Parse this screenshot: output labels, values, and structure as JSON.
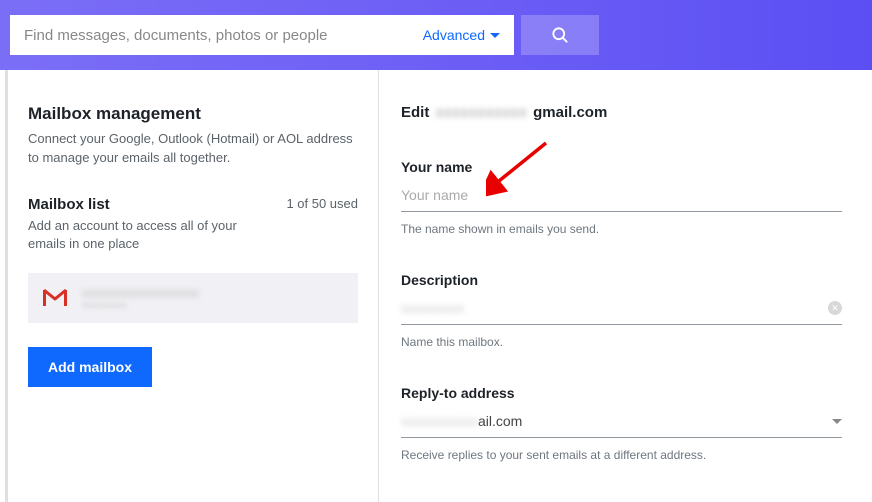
{
  "search": {
    "placeholder": "Find messages, documents, photos or people",
    "advanced_label": "Advanced"
  },
  "left": {
    "title": "Mailbox management",
    "desc": "Connect your Google, Outlook (Hotmail) or AOL address to manage your emails all together.",
    "list_title": "Mailbox list",
    "list_sub": "Add an account to access all of your emails in one place",
    "count": "1 of 50 used",
    "account_masked": "xxxxxxxxxxxxxxxxxx",
    "account_masked_sub": "xxxxxxxxx",
    "add_button": "Add mailbox"
  },
  "right": {
    "edit_label": "Edit",
    "edit_email_masked": "xxxxxxxxxxx",
    "edit_email_suffix": "gmail.com",
    "yourname": {
      "label": "Your name",
      "placeholder": "Your name",
      "help": "The name shown in emails you send."
    },
    "description": {
      "label": "Description",
      "value_masked": "xxxxxxxxx",
      "help": "Name this mailbox."
    },
    "replyto": {
      "label": "Reply-to address",
      "value_masked": "xxxxxxxxxxx",
      "value_suffix": "ail.com",
      "help": "Receive replies to your sent emails at a different address."
    }
  }
}
